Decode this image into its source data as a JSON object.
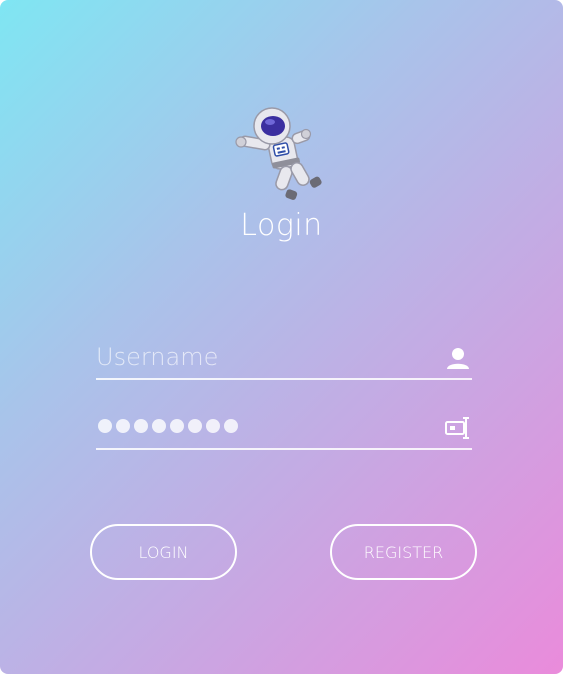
{
  "form": {
    "title": "Login",
    "username_placeholder": "Username",
    "username_value": "",
    "password_masked_length": 8
  },
  "buttons": {
    "login_label": "LOGIN",
    "register_label": "REGISTER"
  },
  "icons": {
    "mascot": "astronaut-icon",
    "username": "user-icon",
    "password": "password-icon"
  },
  "colors": {
    "gradient_start": "#7fe6f3",
    "gradient_mid1": "#a9c3ea",
    "gradient_mid2": "#c6a9e3",
    "gradient_end": "#ea8bdb",
    "text": "#ffffff"
  }
}
